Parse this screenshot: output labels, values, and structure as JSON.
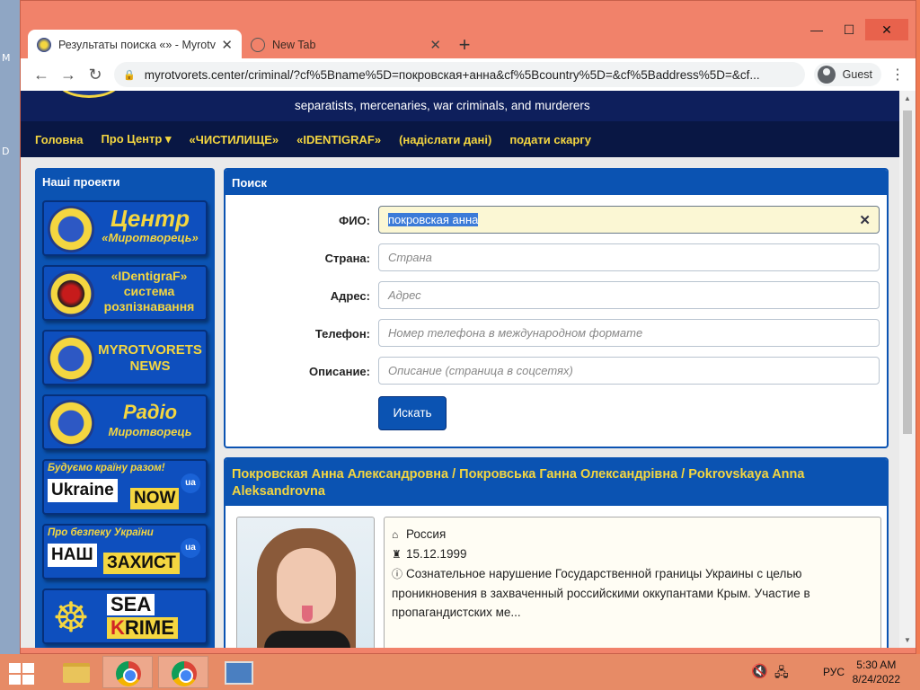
{
  "desktop": {
    "labels": [
      "M",
      "D"
    ]
  },
  "window": {
    "min": "—",
    "max": "☐",
    "close": "✕"
  },
  "tabs": [
    {
      "title": "Результаты поиска «» - Myrotvorets",
      "close": "✕"
    },
    {
      "title": "New Tab",
      "close": "✕"
    }
  ],
  "new_tab": "+",
  "toolbar": {
    "back": "←",
    "forward": "→",
    "reload": "↻",
    "lock": "🔒",
    "url": "myrotvorets.center/criminal/?cf%5Bname%5D=покровская+анна&cf%5Bcountry%5D=&cf%5Baddress%5D=&cf...",
    "profile": "Guest",
    "menu": "⋮"
  },
  "site": {
    "tagline": "separatists, mercenaries, war criminals, and murderers",
    "nav": [
      "Головна",
      "Про Центр ▾",
      "«ЧИСТИЛИЩЕ»",
      "«IDENTIGRAF»",
      "(надіслати дані)",
      "подати скаргу"
    ]
  },
  "sidebar": {
    "title": "Наші проекти",
    "p1": {
      "big": "Центр",
      "small": "«Миротворець»"
    },
    "p2": {
      "l1": "«IDentigraF»",
      "l2": "система",
      "l3": "розпізнавання"
    },
    "p3": {
      "l1": "MYROTVORETS",
      "l2": "NEWS"
    },
    "p4": {
      "big": "Радіо",
      "small": "Миротворець"
    },
    "p5": {
      "top": "Будуємо країну разом!",
      "white": "Ukraine",
      "yellow": "NOW",
      "ua": "ua"
    },
    "p6": {
      "top": "Про безпеку України",
      "white": "НАШ",
      "yellow": "ЗАХИСТ",
      "ua": "ua"
    },
    "p7": {
      "sea": "SEA",
      "k": "K",
      "rime": "RIME"
    }
  },
  "search": {
    "title": "Поиск",
    "fields": {
      "fio": {
        "label": "ФИО:",
        "value": "покровская анна"
      },
      "country": {
        "label": "Страна:",
        "placeholder": "Страна"
      },
      "address": {
        "label": "Адрес:",
        "placeholder": "Адрес"
      },
      "phone": {
        "label": "Телефон:",
        "placeholder": "Номер телефона в международном формате"
      },
      "desc": {
        "label": "Описание:",
        "placeholder": "Описание (страница в соцсетях)"
      }
    },
    "clear": "✕",
    "submit": "Искать"
  },
  "result": {
    "title": "Покровская Анна Александровна / Покровська Ганна Олександрівна / Pokrovskaya Anna Aleksandrovna",
    "country": "Россия",
    "dob": "15.12.1999",
    "desc": "Сознательное нарушение Государственной границы Украины с целью проникновения в захваченный российскими оккупантами Крым. Участие в пропагандистских ме..."
  },
  "taskbar": {
    "lang": "РУС",
    "time": "5:30 AM",
    "date": "8/24/2022"
  }
}
